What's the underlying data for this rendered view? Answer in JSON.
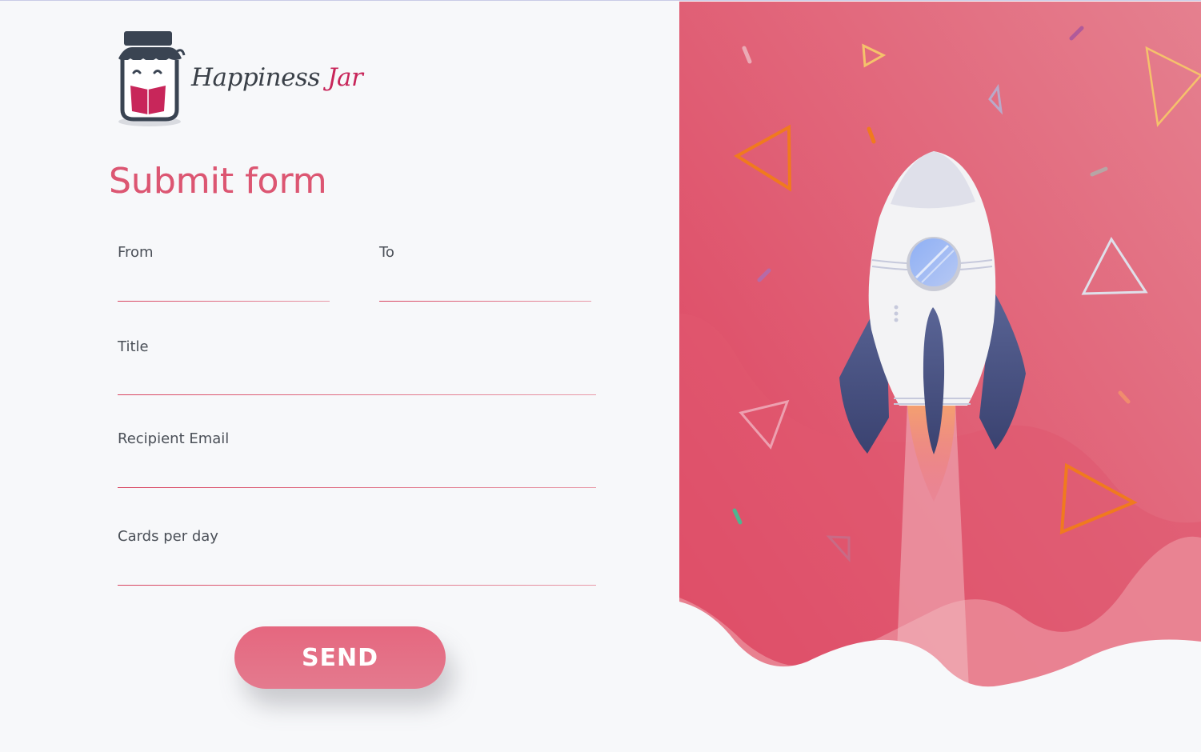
{
  "brand": {
    "name_part1": "Happiness",
    "name_part2": "Jar",
    "logo_icon": "jar-reading-book-icon"
  },
  "form": {
    "title": "Submit form",
    "fields": {
      "from": {
        "label": "From",
        "value": ""
      },
      "to": {
        "label": "To",
        "value": ""
      },
      "title": {
        "label": "Title",
        "value": ""
      },
      "recipient_email": {
        "label": "Recipient Email",
        "value": ""
      },
      "cards_per_day": {
        "label": "Cards per day",
        "value": ""
      }
    },
    "submit_label": "SEND"
  },
  "illustration": {
    "icon": "rocket-launch-icon"
  },
  "colors": {
    "accent": "#dc5672",
    "accent_dark": "#d43c5e",
    "panel_pink": "#e1516e",
    "page_bg": "#f7f8fa",
    "text_dark": "#4a4f57",
    "rocket_body": "#f3f3f5",
    "rocket_fins": "#4a5480",
    "orange": "#f07a1e"
  }
}
